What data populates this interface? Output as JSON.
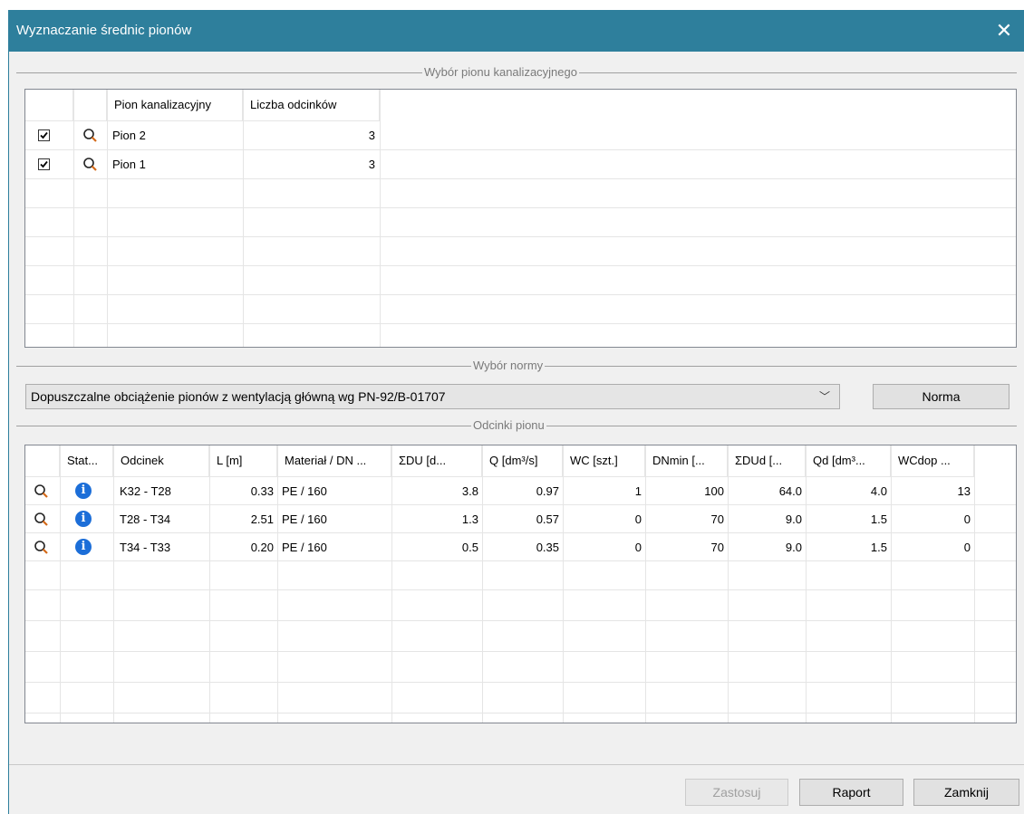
{
  "window": {
    "title": "Wyznaczanie średnic pionów",
    "close_glyph": "✕"
  },
  "group_pion": {
    "label": "Wybór pionu kanalizacyjnego",
    "columns": [
      "Pion kanalizacyjny",
      "Liczba odcinków"
    ],
    "rows": [
      {
        "checked": true,
        "name": "Pion 2",
        "count": "3"
      },
      {
        "checked": true,
        "name": "Pion 1",
        "count": "3"
      }
    ]
  },
  "group_norma": {
    "label": "Wybór normy",
    "selected": "Dopuszczalne obciążenie pionów z wentylacją główną wg PN-92/B-01707",
    "button": "Norma"
  },
  "group_odcinki": {
    "label": "Odcinki pionu",
    "columns": [
      "Stat...",
      "Odcinek",
      "L [m]",
      "Materiał / DN ...",
      "ΣDU [d...",
      "Q [dm³/s]",
      "WC [szt.]",
      "DNmin [...",
      "ΣDUd [...",
      "Qd [dm³...",
      "WCdop ..."
    ],
    "rows": [
      {
        "odcinek": "K32 - T28",
        "l": "0.33",
        "material": "PE / 160",
        "sdu": "3.8",
        "q": "0.97",
        "wc": "1",
        "dnmin": "100",
        "sdud": "64.0",
        "qd": "4.0",
        "wcdop": "13"
      },
      {
        "odcinek": "T28 - T34",
        "l": "2.51",
        "material": "PE / 160",
        "sdu": "1.3",
        "q": "0.57",
        "wc": "0",
        "dnmin": "70",
        "sdud": "9.0",
        "qd": "1.5",
        "wcdop": "0"
      },
      {
        "odcinek": "T34 - T33",
        "l": "0.20",
        "material": "PE / 160",
        "sdu": "0.5",
        "q": "0.35",
        "wc": "0",
        "dnmin": "70",
        "sdud": "9.0",
        "qd": "1.5",
        "wcdop": "0"
      }
    ]
  },
  "footer": {
    "apply": "Zastosuj",
    "report": "Raport",
    "close": "Zamknij"
  },
  "colors": {
    "titlebar": "#2e7f9c",
    "dialog_bg": "#f0f0f0",
    "info": "#1c6ed8",
    "magnifier_handle": "#d46a1a"
  }
}
